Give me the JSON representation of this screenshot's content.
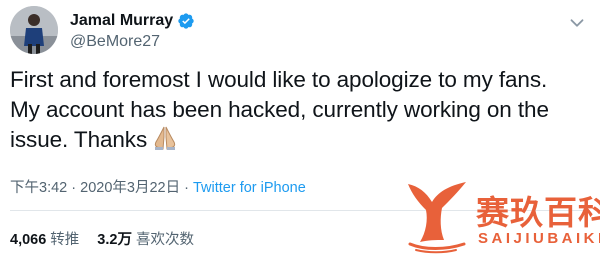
{
  "user": {
    "display_name": "Jamal Murray",
    "handle": "@BeMore27",
    "verified": true
  },
  "icons": {
    "verified": "verified-badge-icon",
    "more": "chevron-down-icon",
    "emoji": "folded-hands-emoji"
  },
  "tweet": {
    "line1": "First and foremost I would like to apologize to my fans.",
    "line2": "My account has been hacked, currently working on the",
    "line3": "issue. Thanks"
  },
  "meta": {
    "time": "下午3:42",
    "separator1": " · ",
    "date": "2020年3月22日",
    "separator2": " · ",
    "source": "Twitter for iPhone"
  },
  "stats": {
    "retweets_count": "4,066",
    "retweets_label": "转推",
    "likes_count": "3.2万",
    "likes_label": "喜欢次数"
  },
  "watermark": {
    "chinese": "赛玖百科",
    "latin": "SAIJIUBAIKE"
  },
  "colors": {
    "accent_blue": "#1d9bf0",
    "secondary_text": "#536471",
    "watermark_orange": "#e8613a"
  }
}
